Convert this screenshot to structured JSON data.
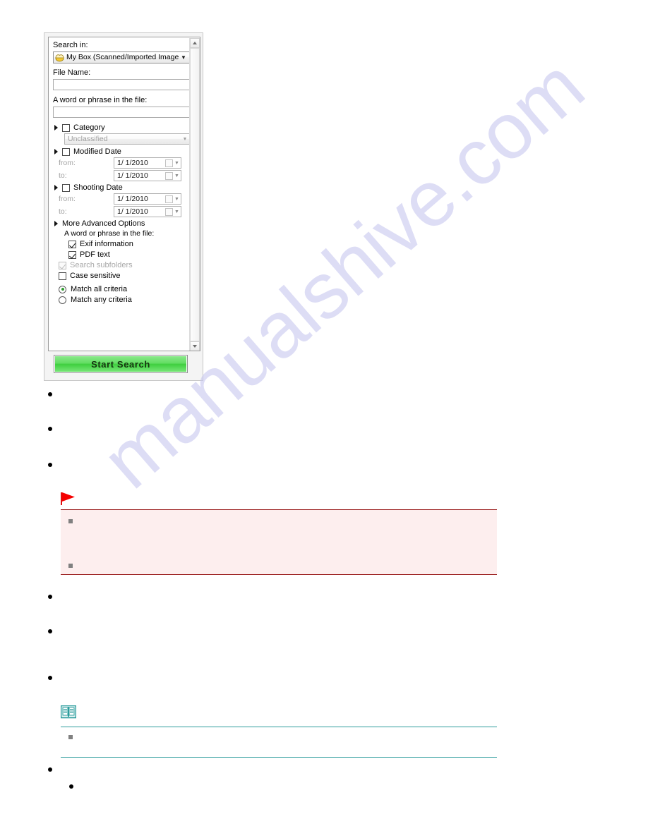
{
  "panel": {
    "search_in_label": "Search in:",
    "search_in_value": "My Box (Scanned/Imported Images)",
    "search_in_icon": "my-box-icon",
    "file_name_label": "File Name:",
    "file_name_value": "",
    "word_phrase_label": "A word or phrase in the file:",
    "word_phrase_value": "",
    "category": {
      "label": "Category",
      "checked": false,
      "value": "Unclassified"
    },
    "modified_date": {
      "label": "Modified Date",
      "checked": false,
      "from_label": "from:",
      "from_value": "1/  1/2010",
      "to_label": "to:",
      "to_value": "1/  1/2010"
    },
    "shooting_date": {
      "label": "Shooting Date",
      "checked": false,
      "from_label": "from:",
      "from_value": "1/  1/2010",
      "to_label": "to:",
      "to_value": "1/  1/2010"
    },
    "advanced": {
      "label": "More Advanced Options",
      "sub_label": "A word or phrase in the file:",
      "options": [
        {
          "label": "Exif information",
          "checked": true,
          "disabled": false
        },
        {
          "label": "PDF text",
          "checked": true,
          "disabled": false
        },
        {
          "label": "Search subfolders",
          "checked": true,
          "disabled": true
        },
        {
          "label": "Case sensitive",
          "checked": false,
          "disabled": false
        }
      ],
      "radios": [
        {
          "label": "Match all criteria",
          "selected": true
        },
        {
          "label": "Match any criteria",
          "selected": false
        }
      ]
    },
    "start_search_label": "Start Search"
  },
  "document": {
    "caution_icon": "red-flag-icon",
    "note_icon": "note-book-icon",
    "bullets": [
      "",
      "",
      "",
      "",
      "",
      "",
      ""
    ],
    "caution_items": [
      "",
      ""
    ],
    "note_items": [
      ""
    ]
  },
  "watermark": {
    "text": "manualshive.com"
  },
  "colors": {
    "accent_green": "#3fcf3f",
    "caution_border": "#9c2020",
    "caution_bg": "#fdeeee",
    "note_border": "#2c9c9c",
    "watermark": "#c9c9ef"
  }
}
